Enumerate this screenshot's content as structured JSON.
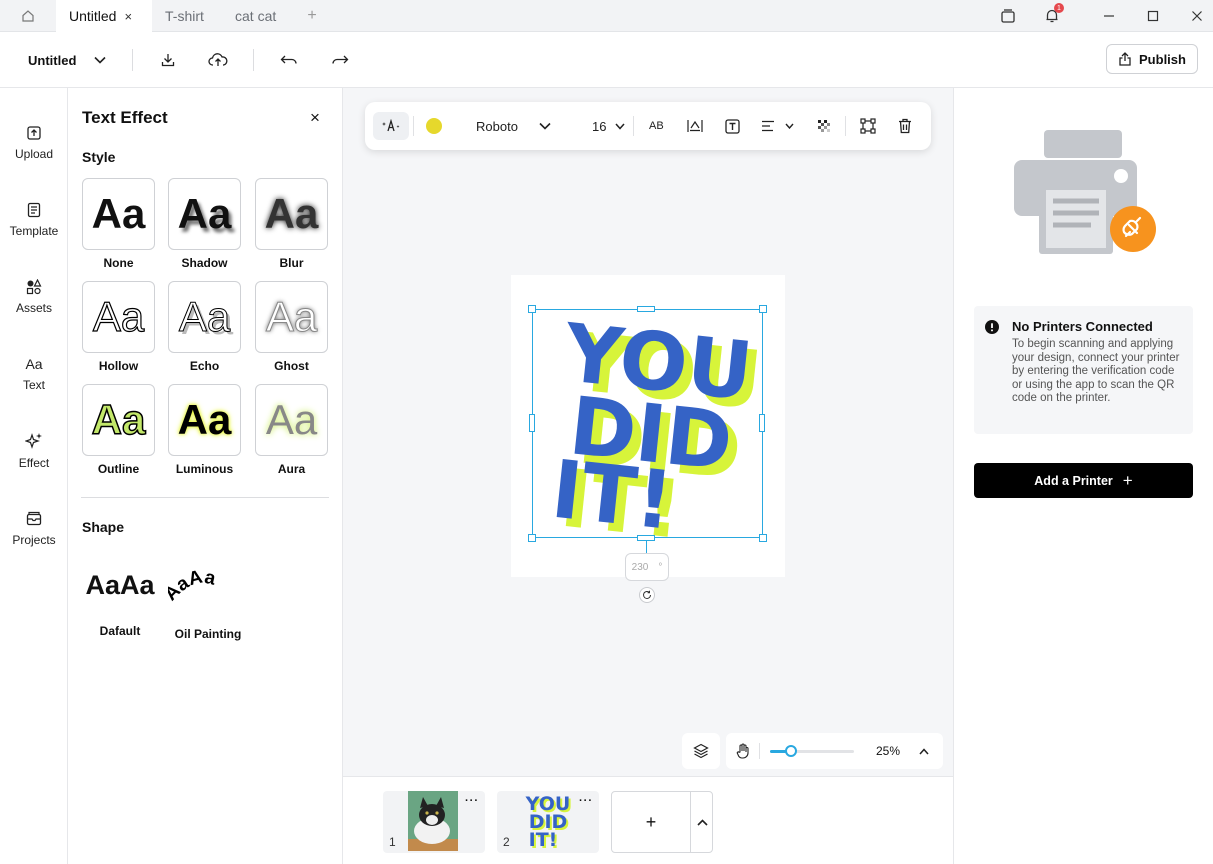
{
  "tabs": {
    "home_icon": "home-icon",
    "items": [
      {
        "label": "Untitled",
        "active": true,
        "close": "×"
      },
      {
        "label": "T-shirt"
      },
      {
        "label": "cat cat"
      }
    ],
    "new_tab": "+",
    "notification_count": "1"
  },
  "header": {
    "project_name": "Untitled",
    "publish_label": "Publish"
  },
  "rail": [
    {
      "label": "Upload",
      "icon": "upload-icon"
    },
    {
      "label": "Template",
      "icon": "template-icon"
    },
    {
      "label": "Assets",
      "icon": "assets-icon"
    },
    {
      "label": "Text",
      "icon": "text-icon",
      "glyph": "Aa"
    },
    {
      "label": "Effect",
      "icon": "sparkle-icon"
    },
    {
      "label": "Projects",
      "icon": "projects-icon"
    }
  ],
  "panel": {
    "title": "Text Effect",
    "close": "×",
    "style_label": "Style",
    "shape_label": "Shape",
    "sample": "Aa",
    "styles": [
      "None",
      "Shadow",
      "Blur",
      "Hollow",
      "Echo",
      "Ghost",
      "Outline",
      "Luminous",
      "Aura"
    ],
    "shapes": [
      {
        "name": "Dafault",
        "sample": "AaAa"
      },
      {
        "name": "Oil Painting",
        "sample": "AaAa"
      }
    ]
  },
  "text_toolbar": {
    "font": "Roboto",
    "size": "16",
    "case": "AB",
    "text_color": "#e6d82c"
  },
  "canvas": {
    "design_text": [
      "YOU",
      "DID",
      "IT!"
    ],
    "design_fill": "#3563c6",
    "design_shadow": "#d7f43a",
    "rotation": "230",
    "rotation_unit": "°",
    "zoom_label": "25%",
    "zoom_level": 0.25
  },
  "pages": [
    {
      "num": "1",
      "more": "···"
    },
    {
      "num": "2",
      "more": "···",
      "design_text": [
        "YOU",
        "DID",
        "IT!"
      ]
    }
  ],
  "add_page": "+",
  "printer": {
    "title": "No Printers Connected",
    "body": "To begin scanning and applying your design, connect your printer by entering the verification code or using the app to scan the QR code on the printer.",
    "button": "Add a Printer",
    "button_plus": "+"
  },
  "colors": {
    "accent": "#29a8e0",
    "printer_badge": "#f7931e",
    "printer_body": "#c4c7cc"
  }
}
